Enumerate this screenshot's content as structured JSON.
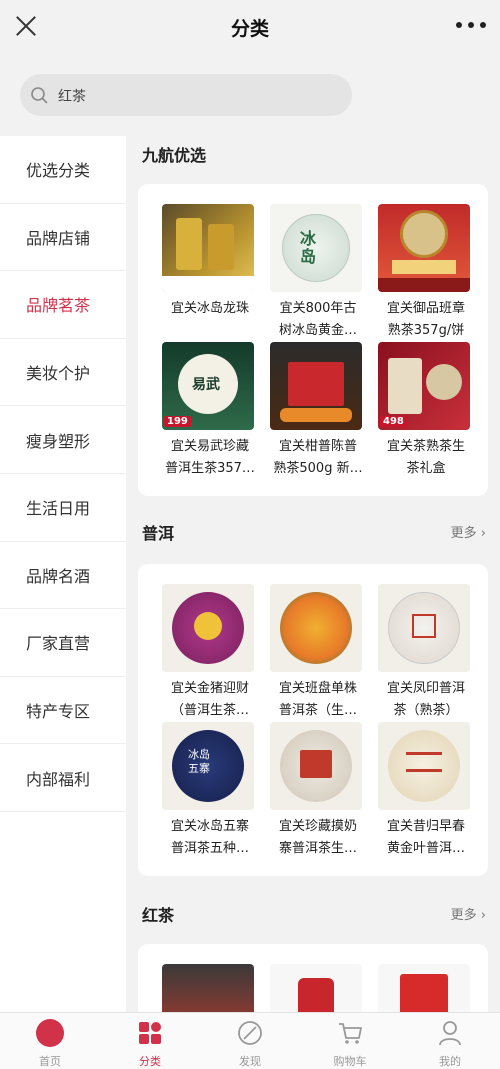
{
  "header": {
    "title": "分类"
  },
  "search": {
    "value": "红茶"
  },
  "sidebar": {
    "items": [
      {
        "label": "优选分类"
      },
      {
        "label": "品牌店铺"
      },
      {
        "label": "品牌茗茶"
      },
      {
        "label": "美妆个护"
      },
      {
        "label": "瘦身塑形"
      },
      {
        "label": "生活日用"
      },
      {
        "label": "品牌名酒"
      },
      {
        "label": "厂家直营"
      },
      {
        "label": "特产专区"
      },
      {
        "label": "内部福利"
      }
    ],
    "active_label": "品牌茗茶",
    "active_color": "#d2314a"
  },
  "sections": [
    {
      "title": "九航优选",
      "more": "",
      "products": [
        {
          "line1": "宜关冰岛龙珠",
          "line2": ""
        },
        {
          "line1": "宜关800年古",
          "line2": "树冰岛黄金…"
        },
        {
          "line1": "宜关御品班章",
          "line2": "熟茶357g/饼"
        },
        {
          "line1": "宜关易武珍藏",
          "line2": "普洱生茶357…",
          "badge": "199"
        },
        {
          "line1": "宜关柑普陈普",
          "line2": "熟茶500g 新…"
        },
        {
          "line1": "宜关茶熟茶生",
          "line2": "茶礼盒",
          "badge": "498"
        }
      ]
    },
    {
      "title": "普洱",
      "more": "更多",
      "products": [
        {
          "line1": "宜关金猪迎财",
          "line2": "（普洱生茶…"
        },
        {
          "line1": "宜关班盘单株",
          "line2": "普洱茶（生…"
        },
        {
          "line1": "宜关凤印普洱",
          "line2": "茶（熟茶）"
        },
        {
          "line1": "宜关冰岛五寨",
          "line2": "普洱茶五种…"
        },
        {
          "line1": "宜关珍藏摸奶",
          "line2": "寨普洱茶生…"
        },
        {
          "line1": "宜关昔归早春",
          "line2": "黄金叶普洱…"
        }
      ]
    },
    {
      "title": "红茶",
      "more": "更多",
      "products": []
    }
  ],
  "tabbar": {
    "tabs": [
      {
        "label": "首页",
        "icon": "home-logo-icon"
      },
      {
        "label": "分类",
        "icon": "category-icon"
      },
      {
        "label": "发现",
        "icon": "discover-icon"
      },
      {
        "label": "购物车",
        "icon": "cart-icon"
      },
      {
        "label": "我的",
        "icon": "user-icon"
      }
    ],
    "active_label": "分类"
  }
}
